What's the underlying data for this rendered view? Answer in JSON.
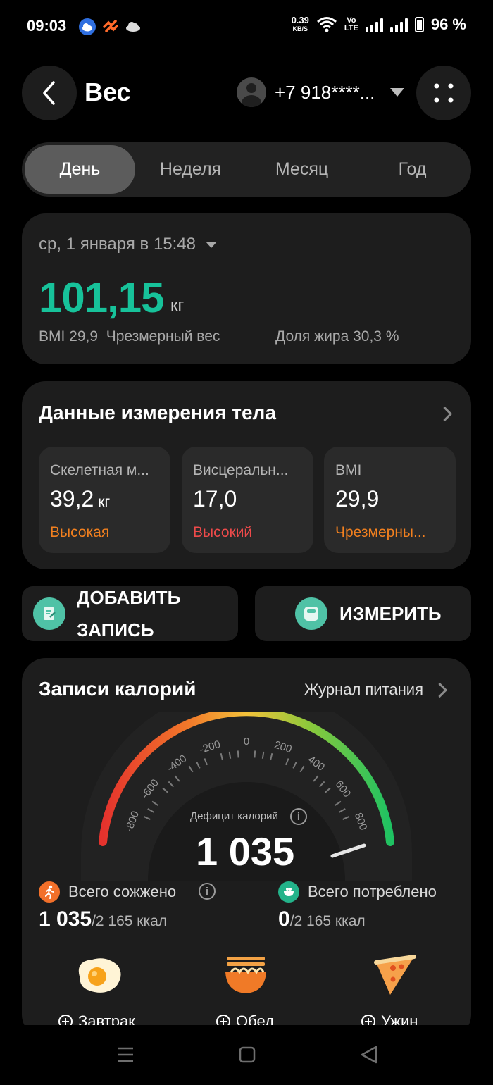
{
  "status_bar": {
    "time": "09:03",
    "net_speed_value": "0.39",
    "net_speed_unit": "KB/S",
    "volte_top": "Vo",
    "volte_bottom": "LTE",
    "battery": "96 %"
  },
  "header": {
    "title": "Вес",
    "account": "+7 918****..."
  },
  "tabs": [
    "День",
    "Неделя",
    "Месяц",
    "Год"
  ],
  "active_tab": "День",
  "summary": {
    "date": "ср, 1 января в 15:48",
    "weight": "101,15",
    "weight_unit": "кг",
    "bmi": "BMI 29,9",
    "bmi_status": "Чрезмерный вес",
    "fat": "Доля жира 30,3 %"
  },
  "body_data": {
    "title": "Данные измерения тела",
    "items": [
      {
        "label": "Скелетная м...",
        "value": "39,2",
        "unit": "кг",
        "status": "Высокая",
        "status_color": "#f2801f"
      },
      {
        "label": "Висцеральн...",
        "value": "17,0",
        "unit": "",
        "status": "Высокий",
        "status_color": "#ee4a4a"
      },
      {
        "label": "BMI",
        "value": "29,9",
        "unit": "",
        "status": "Чрезмерны...",
        "status_color": "#f2801f"
      }
    ]
  },
  "actions": {
    "add_line1": "ДОБАВИТЬ",
    "add_line2": "ЗАПИСЬ",
    "measure": "ИЗМЕРИТЬ",
    "accent": "#4fc2a6"
  },
  "calories": {
    "title": "Записи калорий",
    "journal_link": "Журнал питания",
    "gauge_ticks": [
      "-800",
      "-600",
      "-400",
      "-200",
      "0",
      "200",
      "400",
      "600",
      "800"
    ],
    "deficit_label": "Дефицит калорий",
    "deficit_value": "1 035",
    "burned_title": "Всего сожжено",
    "burned_value": "1 035",
    "burned_rest": "/2 165 ккал",
    "consumed_title": "Всего потреблено",
    "consumed_value": "0",
    "consumed_rest": "/2 165 ккал",
    "meals": [
      "Завтрак",
      "Обед",
      "Ужин"
    ]
  },
  "icons": {
    "back": "chevron-left-icon",
    "more": "grid-dots-icon",
    "burned": "running-icon",
    "consumed": "bowl-icon",
    "add": "note-icon",
    "measure": "scale-icon"
  }
}
